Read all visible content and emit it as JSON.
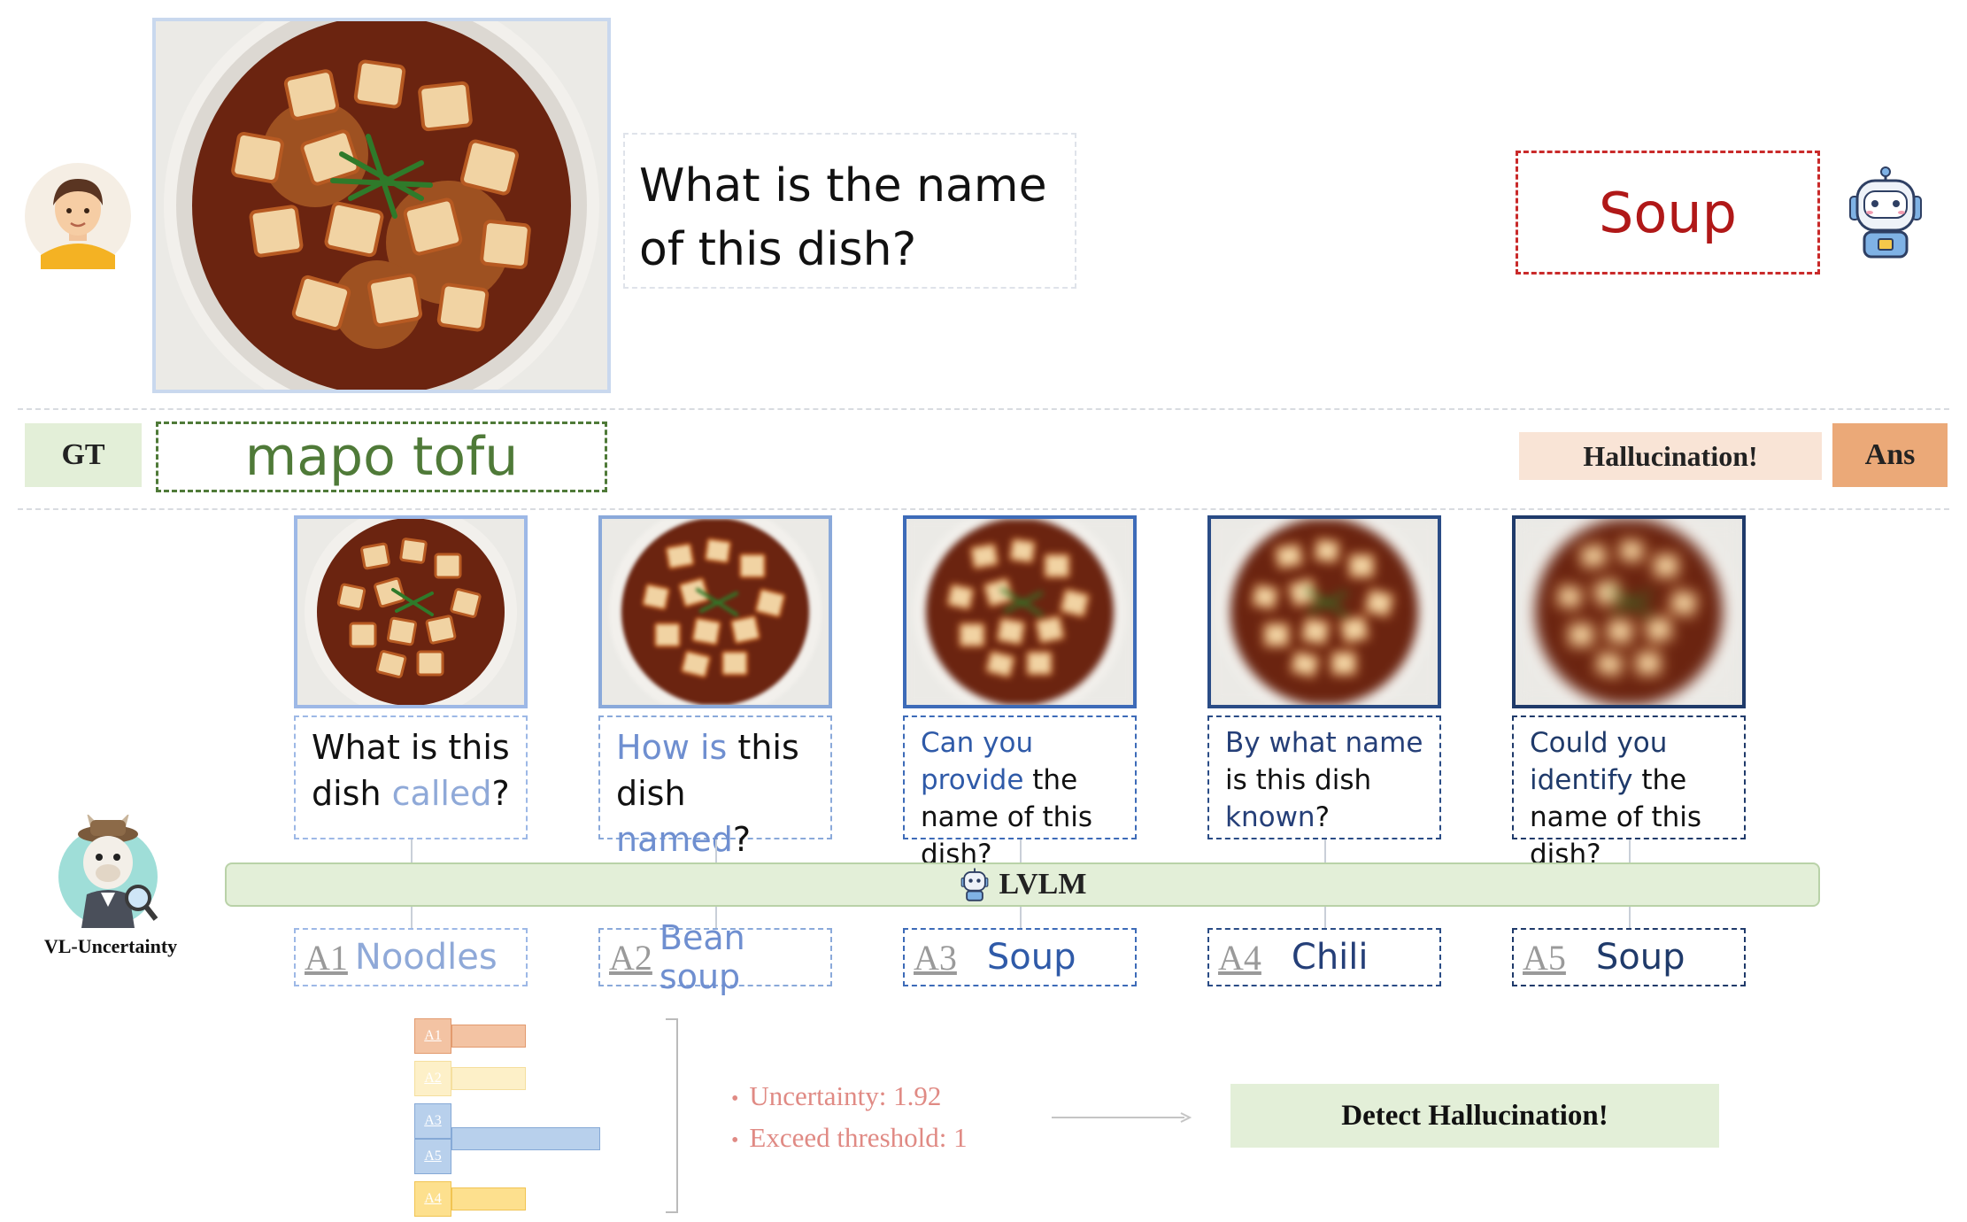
{
  "top": {
    "question": "What is the name of this dish?",
    "answer": "Soup"
  },
  "ground_truth": {
    "tag": "GT",
    "value": "mapo tofu"
  },
  "verdict": {
    "hallucination": "Hallucination!",
    "ans_tag": "Ans"
  },
  "columns": [
    {
      "q_parts": [
        {
          "t": "What is this",
          "hl": false
        },
        {
          "t": " dish ",
          "hl": false
        },
        {
          "t": "called",
          "hl": true
        },
        {
          "t": "?",
          "hl": false
        }
      ],
      "answer_id": "A1",
      "answer": "Noodles",
      "blur": 0,
      "border": "#9db8e6",
      "ans_color": "#8fa9d8",
      "qtext_color": "#111111",
      "hl_color": "#8fa9d8"
    },
    {
      "q_parts": [
        {
          "t": "How is",
          "hl": true
        },
        {
          "t": " this dish ",
          "hl": false
        },
        {
          "t": "named",
          "hl": true
        },
        {
          "t": "?",
          "hl": false
        }
      ],
      "answer_id": "A2",
      "answer": "Bean soup",
      "blur": 2,
      "border": "#8aa9da",
      "ans_color": "#6f8fd0",
      "qtext_color": "#111111",
      "hl_color": "#6f8fd0"
    },
    {
      "q_parts": [
        {
          "t": "Can you provide",
          "hl": true
        },
        {
          "t": " the name of this dish?",
          "hl": false
        }
      ],
      "answer_id": "A3",
      "answer": "Soup",
      "blur": 4,
      "border": "#3d6bb8",
      "ans_color": "#2f5aa8",
      "qtext_color": "#111111",
      "hl_color": "#2f5aa8"
    },
    {
      "q_parts": [
        {
          "t": "By what name",
          "hl": true
        },
        {
          "t": " is this dish ",
          "hl": false
        },
        {
          "t": "known",
          "hl": true
        },
        {
          "t": "?",
          "hl": false
        }
      ],
      "answer_id": "A4",
      "answer": "Chili",
      "blur": 6,
      "border": "#2a4c86",
      "ans_color": "#253f78",
      "qtext_color": "#111111",
      "hl_color": "#253f78"
    },
    {
      "q_parts": [
        {
          "t": "Could you identify",
          "hl": true
        },
        {
          "t": " the name of this dish?",
          "hl": false
        }
      ],
      "answer_id": "A5",
      "answer": "Soup",
      "blur": 8,
      "border": "#1f3a6a",
      "ans_color": "#1f3a6a",
      "qtext_color": "#111111",
      "hl_color": "#1f3a6a"
    }
  ],
  "lvlm_label": "LVLM",
  "vl_label": "VL-Uncertainty",
  "clusters": [
    {
      "ids": [
        "A1"
      ],
      "color": "#f3c3a3",
      "border": "#e29a6e",
      "fraction": 0.2
    },
    {
      "ids": [
        "A2"
      ],
      "color": "#fdf0c8",
      "border": "#f5df9e",
      "fraction": 0.2
    },
    {
      "ids": [
        "A3",
        "A5"
      ],
      "color": "#b8d0ec",
      "border": "#86a9d6",
      "fraction": 0.4
    },
    {
      "ids": [
        "A4"
      ],
      "color": "#fde08e",
      "border": "#f1c452",
      "fraction": 0.2
    }
  ],
  "stats": {
    "uncertainty": "Uncertainty: 1.92",
    "threshold": "Exceed threshold: 1"
  },
  "detect_label": "Detect Hallucination!"
}
